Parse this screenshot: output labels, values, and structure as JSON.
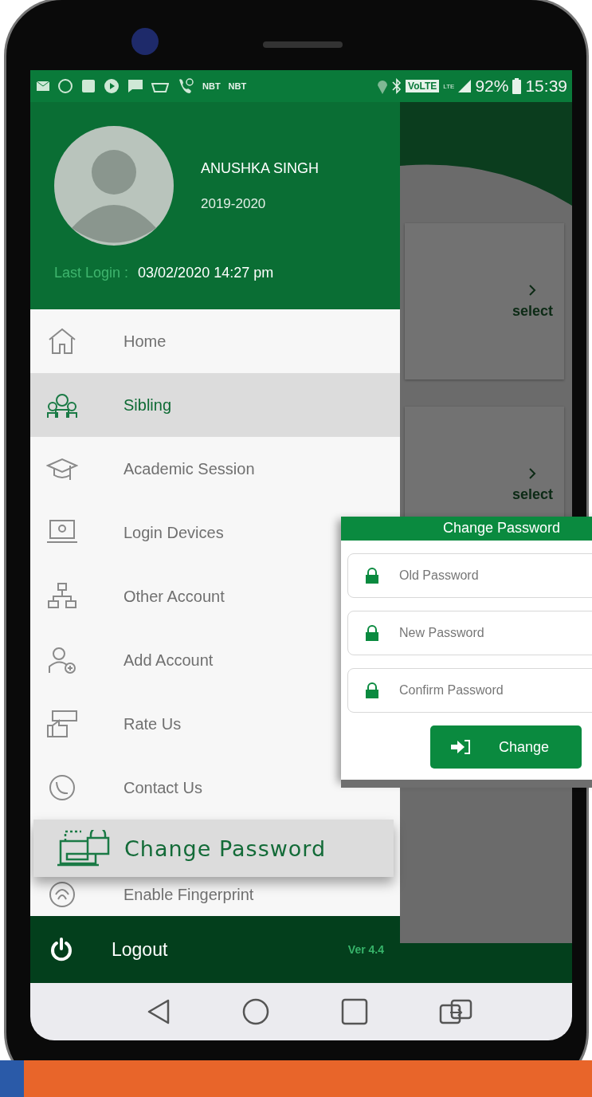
{
  "status_bar": {
    "labels": [
      "NBT",
      "NBT"
    ],
    "network": "VoLTE",
    "lte": "LTE",
    "battery": "92%",
    "time": "15:39"
  },
  "profile": {
    "name": "ANUSHKA  SINGH",
    "session": "2019-2020",
    "last_login_label": "Last Login :",
    "last_login": "03/02/2020  14:27 pm"
  },
  "menu": [
    {
      "label": "Home",
      "selected": false,
      "kind": "item"
    },
    {
      "label": "Sibling",
      "selected": true,
      "kind": "item"
    },
    {
      "label": "Academic Session",
      "selected": false,
      "kind": "item"
    },
    {
      "label": "Login Devices",
      "selected": false,
      "kind": "item"
    },
    {
      "label": "Other Account",
      "selected": false,
      "kind": "item"
    },
    {
      "label": "Add Account",
      "selected": false,
      "kind": "item"
    },
    {
      "label": "Rate Us",
      "selected": false,
      "kind": "item"
    },
    {
      "label": "Contact Us",
      "selected": false,
      "kind": "item"
    },
    {
      "label": "Change Password",
      "selected": false,
      "kind": "callout"
    },
    {
      "label": "Enable Fingerprint",
      "selected": false,
      "kind": "item"
    }
  ],
  "footer": {
    "logout": "Logout",
    "version": "Ver 4.4"
  },
  "background_cards": [
    {
      "action": "select"
    },
    {
      "action": "select"
    }
  ],
  "change_password_dialog": {
    "title": "Change Password",
    "fields": [
      {
        "placeholder": "Old Password"
      },
      {
        "placeholder": "New Password"
      },
      {
        "placeholder": "Confirm Password"
      }
    ],
    "button": "Change"
  }
}
